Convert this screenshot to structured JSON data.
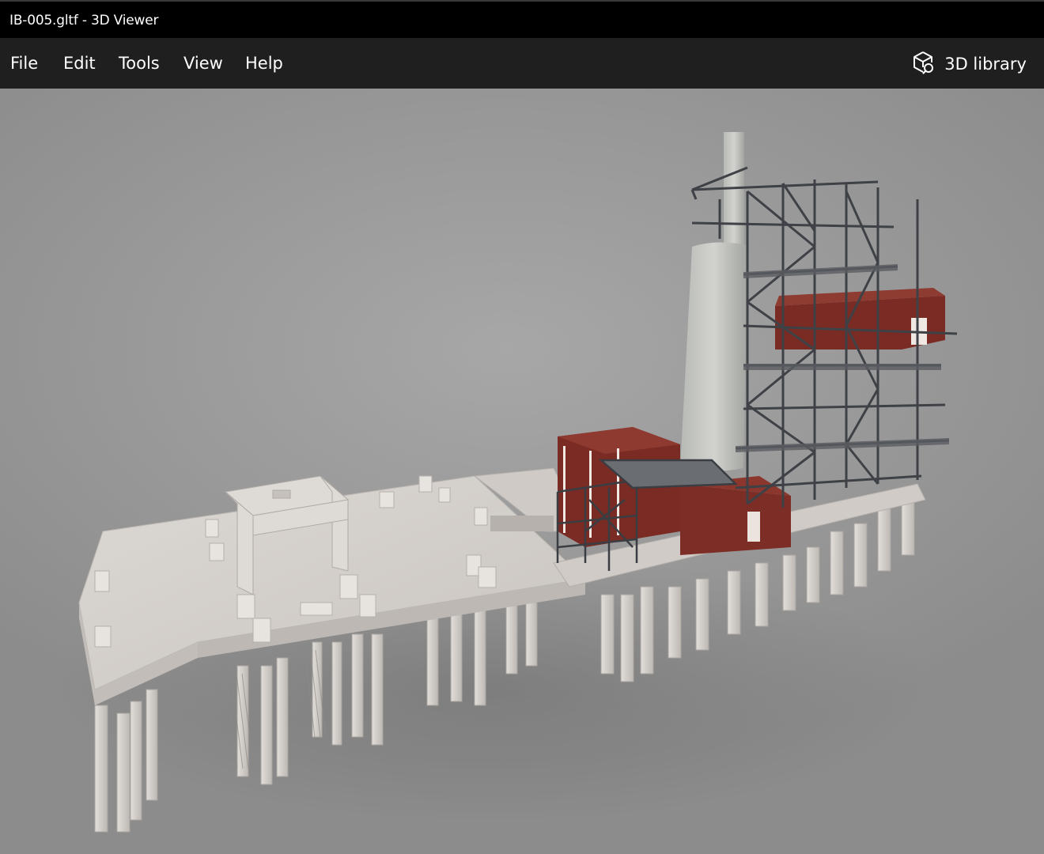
{
  "window": {
    "title": "IB-005.gltf - 3D Viewer"
  },
  "menu": {
    "items": [
      {
        "label": "File"
      },
      {
        "label": "Edit"
      },
      {
        "label": "Tools"
      },
      {
        "label": "View"
      },
      {
        "label": "Help"
      }
    ],
    "library_label": "3D library",
    "library_icon": "3d-cube-search-icon"
  },
  "viewport": {
    "background": "#9a9a9a",
    "model_colors": {
      "concrete": "#d8d3ce",
      "steel": "#4a4d52",
      "cladding": "#7a2a22"
    }
  }
}
